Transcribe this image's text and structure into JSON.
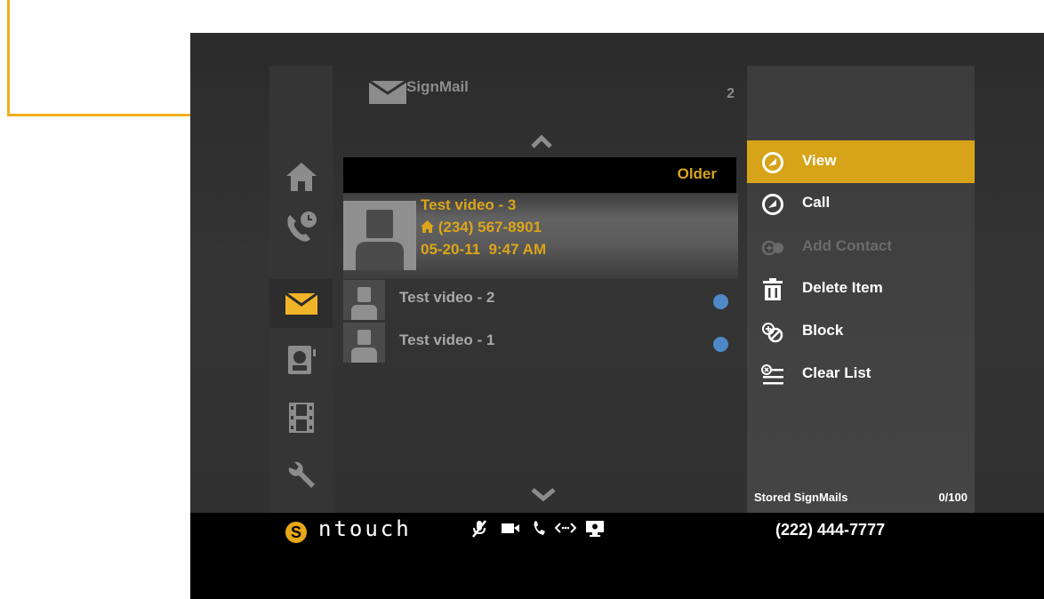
{
  "header": {
    "title": "SignMail",
    "count": "2"
  },
  "list": {
    "older_label": "Older",
    "selected": {
      "title": "Test video - 3",
      "phone": "(234) 567-8901",
      "datetime": "05-20-11  9:47 AM"
    },
    "items": [
      {
        "title": "Test video - 2"
      },
      {
        "title": "Test video - 1"
      }
    ]
  },
  "menu": {
    "items": [
      {
        "label": "View",
        "icon": "arrow-circle-icon",
        "selected": true
      },
      {
        "label": "Call",
        "icon": "arrow-circle-icon"
      },
      {
        "label": "Add Contact",
        "icon": "add-contact-icon",
        "disabled": true
      },
      {
        "label": "Delete Item",
        "icon": "trash-icon"
      },
      {
        "label": "Block",
        "icon": "block-icon"
      },
      {
        "label": "Clear List",
        "icon": "clear-list-icon"
      }
    ],
    "stored_label": "Stored SignMails",
    "stored_count": "0/100"
  },
  "status_bar": {
    "brand": "ntouch",
    "phone_number": "(222) 444-7777"
  },
  "colors": {
    "accent": "#dba51a",
    "callout": "#f0ad1a",
    "unread_dot": "#4f88c6"
  }
}
